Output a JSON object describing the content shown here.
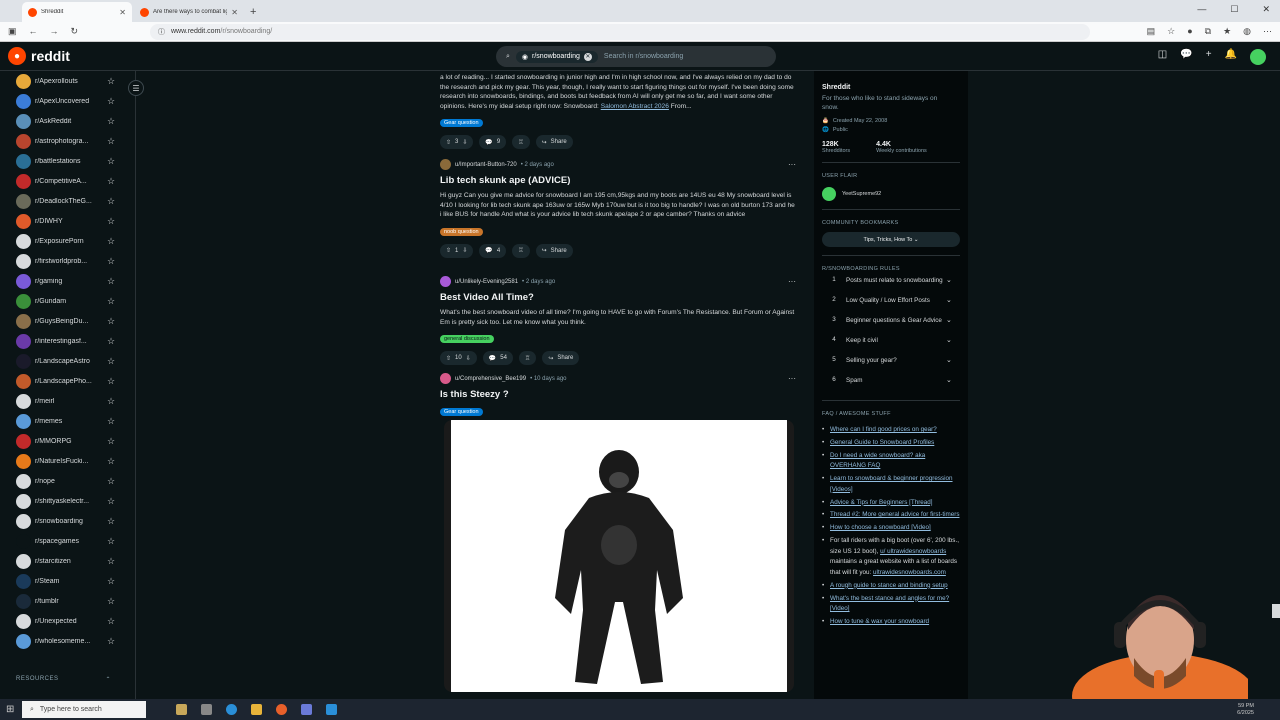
{
  "browser": {
    "tabs": [
      {
        "title": "Shreddit",
        "active": true
      },
      {
        "title": "Are there ways to combat light",
        "active": false
      }
    ],
    "url_host": "www.reddit.com",
    "url_path": "/r/snowboarding/"
  },
  "header": {
    "logo_text": "reddit",
    "search_chip": "r/snowboarding",
    "search_placeholder": "Search in r/snowboarding"
  },
  "sidebar": {
    "items": [
      {
        "name": "r/Apexrollouts",
        "color": "#e8a93a"
      },
      {
        "name": "r/ApexUncovered",
        "color": "#3b7dd8"
      },
      {
        "name": "r/AskReddit",
        "color": "#5a8fb8"
      },
      {
        "name": "r/astrophotogra...",
        "color": "#b8452e"
      },
      {
        "name": "r/battlestations",
        "color": "#2a6f96"
      },
      {
        "name": "r/CompetitiveA...",
        "color": "#c22a2a"
      },
      {
        "name": "r/DeadlockTheG...",
        "color": "#6a6a5a"
      },
      {
        "name": "r/DIWHY",
        "color": "#e05a2a"
      },
      {
        "name": "r/ExposurePorn",
        "color": "#d7dadc"
      },
      {
        "name": "r/firstworldprob...",
        "color": "#d7dadc"
      },
      {
        "name": "r/gaming",
        "color": "#7a5ad8"
      },
      {
        "name": "r/Gundam",
        "color": "#3a8f3a"
      },
      {
        "name": "r/GuysBeingDu...",
        "color": "#8a6f4a"
      },
      {
        "name": "r/interestingasf...",
        "color": "#6a3aa8"
      },
      {
        "name": "r/LandscapeAstro",
        "color": "#1a1a2a"
      },
      {
        "name": "r/LandscapePho...",
        "color": "#c25a2a"
      },
      {
        "name": "r/meirl",
        "color": "#d7dadc"
      },
      {
        "name": "r/memes",
        "color": "#5a9ad8"
      },
      {
        "name": "r/MMORPG",
        "color": "#c22a2a"
      },
      {
        "name": "r/NatureIsFucki...",
        "color": "#e87a1a"
      },
      {
        "name": "r/nope",
        "color": "#d7dadc"
      },
      {
        "name": "r/shittyaskelectr...",
        "color": "#d7dadc"
      },
      {
        "name": "r/snowboarding",
        "color": "#d7dadc"
      },
      {
        "name": "r/spacegames",
        "color": "#0b1416"
      },
      {
        "name": "r/starcitizen",
        "color": "#d7dadc"
      },
      {
        "name": "r/Steam",
        "color": "#1a3a5a"
      },
      {
        "name": "r/tumblr",
        "color": "#1a2a3a"
      },
      {
        "name": "r/Unexpected",
        "color": "#d7dadc"
      },
      {
        "name": "r/wholesomeme...",
        "color": "#5a9ad8"
      }
    ],
    "resources_label": "RESOURCES"
  },
  "posts": {
    "p0": {
      "body": "a lot of reading... I started snowboarding in junior high and I'm in high school now, and I've always relied on my dad to do the research and pick my gear. This year, though, I really want to start figuring things out for myself. I've been doing some research into snowboards, bindings, and boots but feedback from AI will only get me so far, and I want some other opinions. Here's my ideal setup right now: Snowboard:",
      "link": "Salomon Abstract 2026",
      "tail": "From...",
      "flair": "Gear question",
      "flair_color": "#0079d3",
      "votes": "3",
      "comments": "9",
      "share": "Share"
    },
    "p1": {
      "user": "u/Important-Button-720",
      "ago": "• 2 days ago",
      "title": "Lib tech skunk ape (ADVICE)",
      "body": "Hi guyz Can you give me advice for snowboard I am 195 cm,95kgs and my boots are 14US eu 48 My snowboard level is 4/10 I looking for lib tech skunk ape 163uw or 165w Myb 170uw but is it too big to handle? I was on old burton 173 and he i like BUS for handle And what is your advice lib tech skunk ape/ape 2 or ape camber? Thanks on advice",
      "flair": "noob question",
      "flair_color": "#c8752a",
      "votes": "1",
      "comments": "4",
      "share": "Share"
    },
    "p2": {
      "user": "u/Unlikely-Evening2581",
      "ago": "• 2 days ago",
      "title": "Best Video All Time?",
      "body": "What's the best snowboard video of all time? I'm going to HAVE to go with Forum's The Resistance. But Forum or Against Em is pretty sick too. Let me know what you think.",
      "flair": "general discussion",
      "flair_color": "#46d160",
      "votes": "10",
      "comments": "54",
      "share": "Share"
    },
    "p3": {
      "user": "u/Comprehensive_Bee199",
      "ago": "• 10 days ago",
      "title": "Is this Steezy ?",
      "flair": "Gear question",
      "flair_color": "#0079d3"
    }
  },
  "right": {
    "name": "Shreddit",
    "desc": "For those who like to stand sideways on snow.",
    "created": "Created May 22, 2008",
    "visibility": "Public",
    "members": "128K",
    "members_label": "Shredditors",
    "weekly": "4.4K",
    "weekly_label": "Weekly contributions",
    "user_flair_head": "USER FLAIR",
    "user_flair_name": "YeetSupreme92",
    "bookmarks_head": "COMMUNITY BOOKMARKS",
    "bookmark_btn": "Tips, Tricks, How To",
    "rules_head": "R/SNOWBOARDING RULES",
    "rules": [
      {
        "n": "1",
        "t": "Posts must relate to snowboarding"
      },
      {
        "n": "2",
        "t": "Low Quality / Low Effort Posts"
      },
      {
        "n": "3",
        "t": "Beginner questions & Gear Advice"
      },
      {
        "n": "4",
        "t": "Keep it civil"
      },
      {
        "n": "5",
        "t": "Selling your gear?"
      },
      {
        "n": "6",
        "t": "Spam"
      }
    ],
    "faq_head": "FAQ / AWESOME STUFF",
    "faq": [
      "Where can I find good prices on gear?",
      "General Guide to Snowboard Profiles",
      "Do I need a wide snowboard? aka OVERHANG FAQ",
      "Learn to snowboard & beginner progression [Videos]",
      "Advice & Tips for Beginners [Thread]",
      "Thread #2: More general advice for first-timers",
      "How to choose a snowboard [Video]"
    ],
    "faq_plain_a": "For tall riders with a big boot (over 6', 200 lbs., size US 12 boot),",
    "faq_plain_link1": "u/ ultrawidesnowboards",
    "faq_plain_b": "maintains a great website with a list of boards that will fit you:",
    "faq_plain_link2": "ultrawidesnowboards.com",
    "faq2": [
      "A rough guide to stance and binding setup",
      "What's the best stance and angles for me? [Video]",
      "How to tune & wax your snowboard"
    ]
  },
  "taskbar": {
    "search_placeholder": "Type here to search",
    "time": "59 PM",
    "date": "6/2025"
  }
}
